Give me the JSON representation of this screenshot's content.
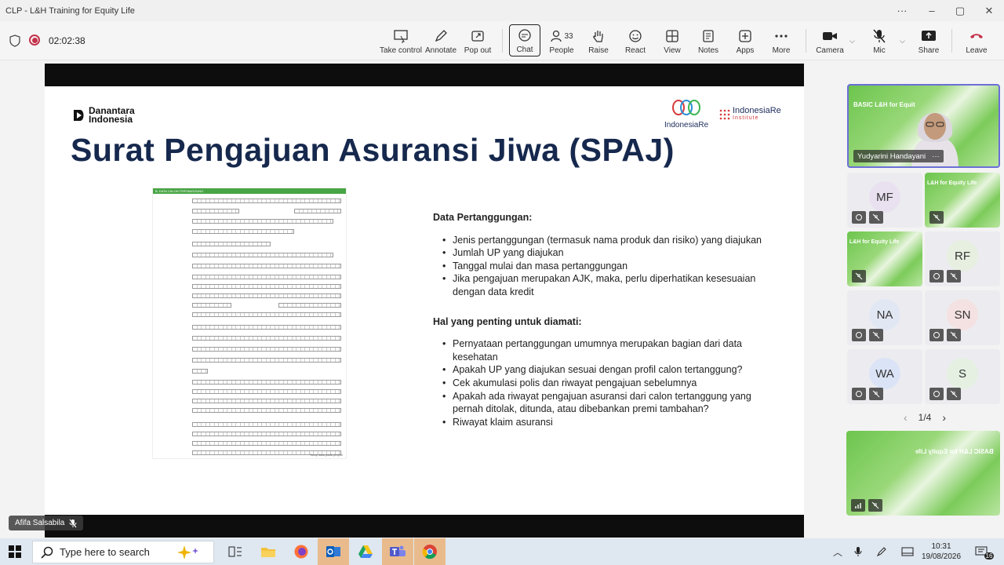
{
  "window": {
    "title": "CLP - L&H Training for Equity Life",
    "controls": [
      "···",
      "–",
      "▢",
      "✕"
    ]
  },
  "meeting": {
    "timer": "02:02:38",
    "toolbar": {
      "take_control": "Take control",
      "annotate": "Annotate",
      "pop_out": "Pop out",
      "chat": "Chat",
      "people": "People",
      "people_count": "33",
      "raise": "Raise",
      "react": "React",
      "view": "View",
      "notes": "Notes",
      "apps": "Apps",
      "more": "More",
      "camera": "Camera",
      "mic": "Mic",
      "share": "Share",
      "leave": "Leave"
    },
    "leave_color": "#c4314b"
  },
  "slide": {
    "logo_left": [
      "Danantara",
      "Indonesia"
    ],
    "logo_mid": "IndonesiaRe",
    "logo_right": [
      "IndonesiaRe",
      "Institute"
    ],
    "title": "Surat Pengajuan Asuransi Jiwa (SPAJ)",
    "title_color": "#16284d",
    "form_header": "B. DATA CALON TERTANGGUNG",
    "form_footer": "Tutup data pada proyek",
    "section1_title": "Data Pertanggungan:",
    "section1_items": [
      "Jenis pertanggungan (termasuk nama produk dan risiko) yang diajukan",
      "Jumlah UP yang diajukan",
      "Tanggal mulai dan masa pertanggungan",
      "Jika pengajuan merupakan AJK, maka, perlu diperhatikan kesesuaian dengan data kredit"
    ],
    "section2_title": "Hal yang penting untuk diamati:",
    "section2_items": [
      "Pernyataan pertanggungan umumnya merupakan bagian dari data kesehatan",
      "Apakah UP yang diajukan sesuai dengan profil calon tertanggung?",
      "Cek akumulasi polis dan riwayat pengajuan sebelumnya",
      "Apakah ada riwayat pengajuan asuransi dari calon tertanggung yang  pernah ditolak, ditunda, atau dibebankan premi tambahan?",
      "Riwayat klaim asuransi"
    ]
  },
  "presenter_label": "Afifa Salsabila",
  "participants": {
    "speaker": "Yudyarini Handayani",
    "speaker_slide_text": "BASIC L&H for Equit",
    "tiles": [
      {
        "initials": "MF",
        "color": "#e9e1f0"
      },
      {
        "initials": "",
        "text": "L&H for Equity Life"
      },
      {
        "initials": "",
        "text": "L&H for Equity Life"
      },
      {
        "initials": "RF",
        "color": "#e6efe0"
      },
      {
        "initials": "NA",
        "color": "#e2e8f3"
      },
      {
        "initials": "SN",
        "color": "#f4e1e1"
      },
      {
        "initials": "WA",
        "color": "#dbe4f6"
      },
      {
        "initials": "S",
        "color": "#e5f0e3"
      }
    ],
    "page": "1/4",
    "self_view_text": "BASIC L&H for Equity Life"
  },
  "taskbar": {
    "search_placeholder": "Type here to search",
    "time": "10:31",
    "date": "19/08/2026",
    "notif_count": "16"
  }
}
